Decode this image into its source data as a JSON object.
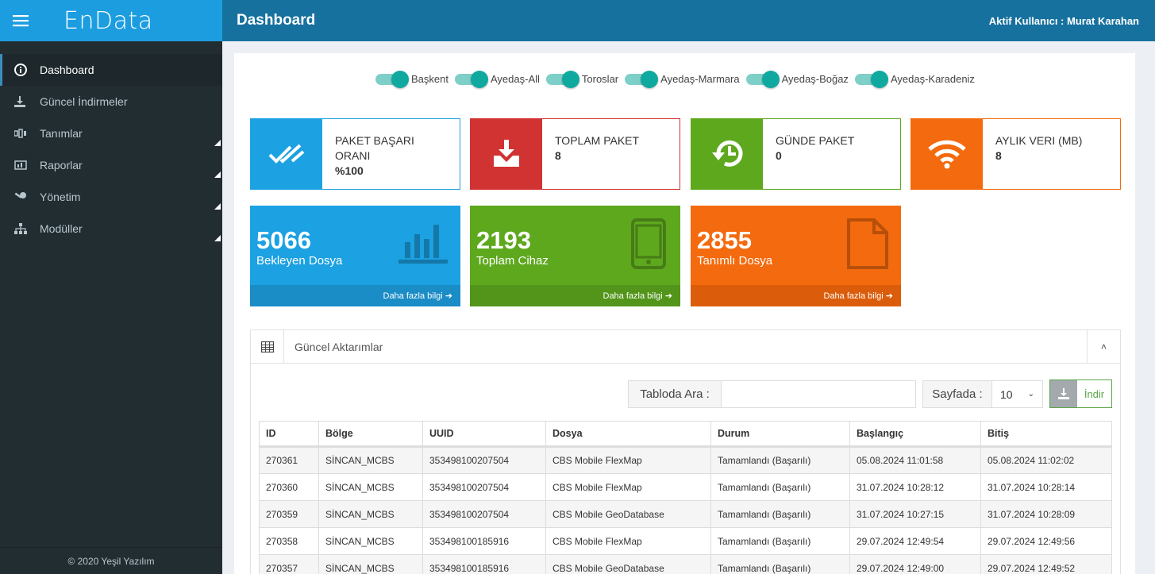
{
  "app": {
    "brand": "EnData"
  },
  "sidebar": {
    "items": [
      {
        "label": "Dashboard",
        "icon": "info-circle-icon",
        "active": true,
        "submenu": false
      },
      {
        "label": "Güncel İndirmeler",
        "icon": "download-icon",
        "active": false,
        "submenu": false
      },
      {
        "label": "Tanımlar",
        "icon": "definitions-icon",
        "active": false,
        "submenu": true
      },
      {
        "label": "Raporlar",
        "icon": "reports-icon",
        "active": false,
        "submenu": true
      },
      {
        "label": "Yönetim",
        "icon": "key-icon",
        "active": false,
        "submenu": true
      },
      {
        "label": "Modüller",
        "icon": "sitemap-icon",
        "active": false,
        "submenu": true
      }
    ],
    "footer": "© 2020 Yeşil Yazılım"
  },
  "header": {
    "title": "Dashboard",
    "user": "Aktif Kullanıcı : Murat Karahan"
  },
  "toggles": [
    {
      "label": "Başkent",
      "on": true
    },
    {
      "label": "Ayedaş-All",
      "on": true
    },
    {
      "label": "Toroslar",
      "on": true
    },
    {
      "label": "Ayedaş-Marmara",
      "on": true
    },
    {
      "label": "Ayedaş-Boğaz",
      "on": true
    },
    {
      "label": "Ayedaş-Karadeniz",
      "on": true
    }
  ],
  "info_boxes": [
    {
      "title": "PAKET BAŞARI ORANI",
      "value": "%100",
      "color": "#1ca1e2",
      "icon": "double-check-icon"
    },
    {
      "title": "TOPLAM PAKET",
      "value": "8",
      "color": "#d13232",
      "icon": "inbox-download-icon"
    },
    {
      "title": "GÜNDE PAKET",
      "value": "0",
      "color": "#5ea81e",
      "icon": "history-icon"
    },
    {
      "title": "AYLIK VERI (MB)",
      "value": "8",
      "color": "#f46a0e",
      "icon": "wifi-icon"
    }
  ],
  "stat_boxes": [
    {
      "number": "5066",
      "caption": "Bekleyen Dosya",
      "more": "Daha fazla bilgi",
      "color": "#1ca1e2",
      "footer_color": "#1a8cc6",
      "icon": "bar-chart-icon"
    },
    {
      "number": "2193",
      "caption": "Toplam Cihaz",
      "more": "Daha fazla bilgi",
      "color": "#5ea81e",
      "footer_color": "#52951a",
      "icon": "tablet-icon"
    },
    {
      "number": "2855",
      "caption": "Tanımlı Dosya",
      "more": "Daha fazla bilgi",
      "color": "#f46a0e",
      "footer_color": "#db5d0b",
      "icon": "file-icon"
    }
  ],
  "panel": {
    "title": "Güncel Aktarımlar",
    "search_label": "Tabloda Ara :",
    "search_value": "",
    "page_label": "Sayfada :",
    "page_size": "10",
    "download_label": "İndir",
    "columns": [
      "ID",
      "Bölge",
      "UUID",
      "Dosya",
      "Durum",
      "Başlangıç",
      "Bitiş"
    ],
    "rows": [
      [
        "270361",
        "SİNCAN_MCBS",
        "353498100207504",
        "CBS Mobile FlexMap",
        "Tamamlandı (Başarılı)",
        "05.08.2024 11:01:58",
        "05.08.2024 11:02:02"
      ],
      [
        "270360",
        "SİNCAN_MCBS",
        "353498100207504",
        "CBS Mobile FlexMap",
        "Tamamlandı (Başarılı)",
        "31.07.2024 10:28:12",
        "31.07.2024 10:28:14"
      ],
      [
        "270359",
        "SİNCAN_MCBS",
        "353498100207504",
        "CBS Mobile GeoDatabase",
        "Tamamlandı (Başarılı)",
        "31.07.2024 10:27:15",
        "31.07.2024 10:28:09"
      ],
      [
        "270358",
        "SİNCAN_MCBS",
        "353498100185916",
        "CBS Mobile FlexMap",
        "Tamamlandı (Başarılı)",
        "29.07.2024 12:49:54",
        "29.07.2024 12:49:56"
      ],
      [
        "270357",
        "SİNCAN_MCBS",
        "353498100185916",
        "CBS Mobile GeoDatabase",
        "Tamamlandı (Başarılı)",
        "29.07.2024 12:49:00",
        "29.07.2024 12:49:52"
      ]
    ]
  }
}
